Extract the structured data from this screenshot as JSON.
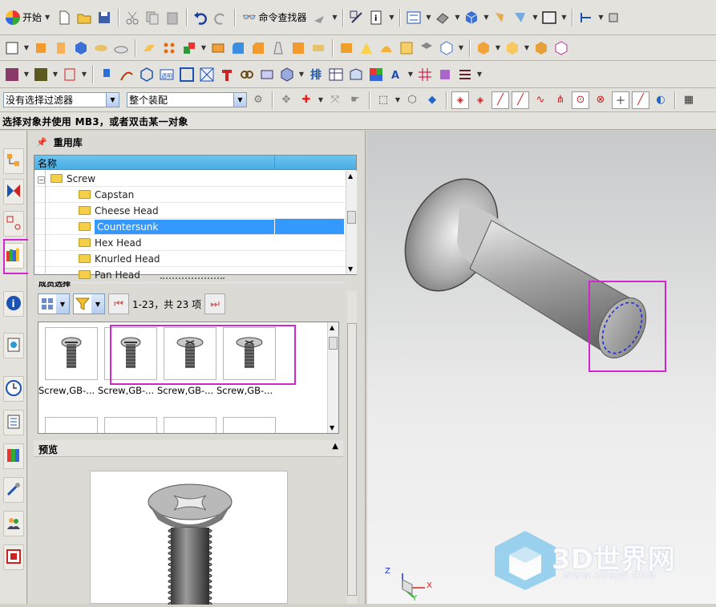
{
  "toolbar1": {
    "start_label": "开始",
    "finder_label": "命令查找器",
    "icons": [
      "start-icon",
      "new-file-icon",
      "open-folder-icon",
      "save-icon",
      "cut-icon",
      "copy-icon",
      "paste-icon",
      "undo-icon",
      "redo-icon",
      "command-finder-icon",
      "select-tool-icon",
      "toggle-icon",
      "info-icon",
      "fit-view-icon",
      "render-style-icon",
      "shaded-box-icon",
      "paint-icon",
      "blend-icon",
      "window-icon",
      "orient-icon"
    ]
  },
  "filter_bar": {
    "type_filter": "没有选择过滤器",
    "scope_filter": "整个装配"
  },
  "status": {
    "prompt": "选择对象并使用 MB3，或者双击某一对象"
  },
  "reuse_library": {
    "title": "重用库",
    "column_name": "名称",
    "tree": [
      {
        "label": "Screw",
        "level": 1,
        "expanded": true,
        "selected": false
      },
      {
        "label": "Capstan",
        "level": 2,
        "selected": false
      },
      {
        "label": "Cheese Head",
        "level": 2,
        "selected": false
      },
      {
        "label": "Countersunk",
        "level": 2,
        "selected": true
      },
      {
        "label": "Hex Head",
        "level": 2,
        "selected": false
      },
      {
        "label": "Knurled Head",
        "level": 2,
        "selected": false
      },
      {
        "label": "Pan Head",
        "level": 2,
        "selected": false
      }
    ],
    "members_header": "成员选择",
    "page_text": "1-23，共 23 项",
    "items": [
      {
        "label": "Screw,GB-..."
      },
      {
        "label": "Screw,GB-..."
      },
      {
        "label": "Screw,GB-..."
      },
      {
        "label": "Screw,GB-..."
      }
    ],
    "preview_title": "预览"
  },
  "viewport": {
    "triad_labels": {
      "x": "X",
      "y": "Y",
      "z": "Z"
    },
    "watermark_brand": "3D世界网",
    "watermark_url": "WWW.3DSJW.COM"
  },
  "colors": {
    "selected_row": "#3399ff",
    "highlight_box": "#d026d0",
    "tree_header": "#5ab8ea"
  }
}
